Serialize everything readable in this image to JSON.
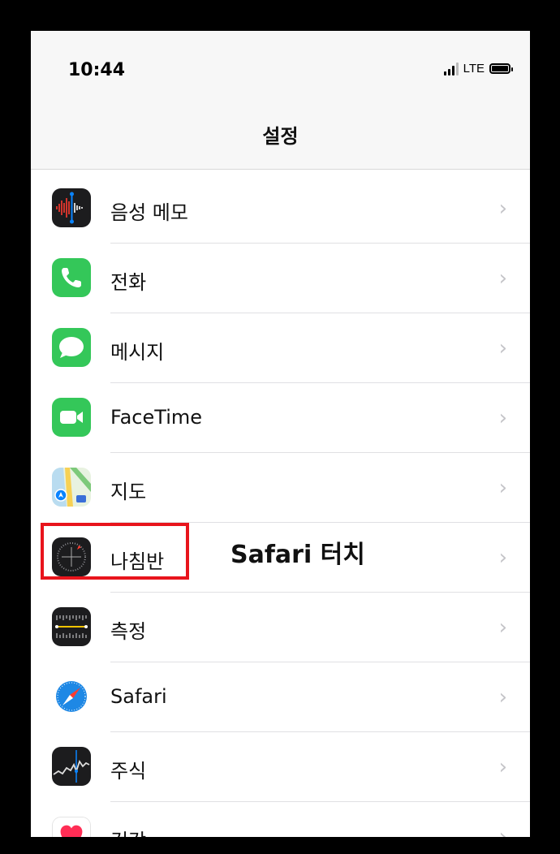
{
  "status_bar": {
    "time": "10:44",
    "network": "LTE"
  },
  "nav": {
    "title": "설정"
  },
  "items": [
    {
      "label": "음성 메모",
      "icon": "voice-memos-icon"
    },
    {
      "label": "전화",
      "icon": "phone-icon"
    },
    {
      "label": "메시지",
      "icon": "messages-icon"
    },
    {
      "label": "FaceTime",
      "icon": "facetime-icon"
    },
    {
      "label": "지도",
      "icon": "maps-icon"
    },
    {
      "label": "나침반",
      "icon": "compass-icon"
    },
    {
      "label": "측정",
      "icon": "measure-icon"
    },
    {
      "label": "Safari",
      "icon": "safari-icon"
    },
    {
      "label": "주식",
      "icon": "stocks-icon"
    },
    {
      "label": "건강",
      "icon": "health-icon"
    }
  ],
  "annotation": {
    "text": "Safari 터치",
    "highlight_color": "#e8141c"
  },
  "colors": {
    "phone_green": "#34c759",
    "safari_blue": "#1e88e5",
    "chevron": "#c4c4c8"
  }
}
